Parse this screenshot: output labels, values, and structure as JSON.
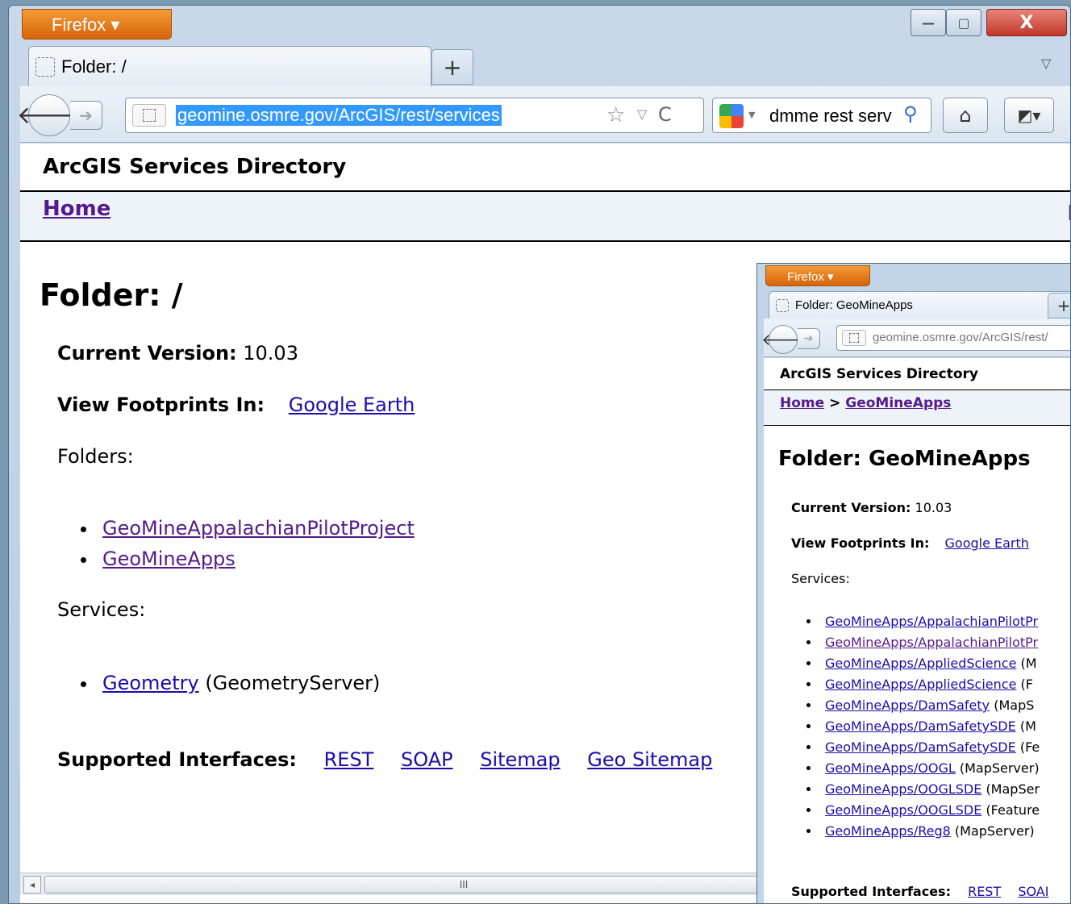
{
  "browser": {
    "menu_label": "Firefox ▾",
    "minimize": "—",
    "maximize": "▢",
    "close": "X",
    "tab_title": "Folder: /",
    "new_tab": "+",
    "tab_list": "▽",
    "back": "🡐",
    "forward": "➔",
    "url": "geomine.osmre.gov/ArcGIS/rest/services",
    "star": "☆",
    "url_dropdown": "▽",
    "reload": "C",
    "search_query": "dmme rest serv",
    "search_icon": "⚲",
    "home_icon": "⌂",
    "bookmarks_icon": "◩▾"
  },
  "page": {
    "header": "ArcGIS Services Directory",
    "home_link": "Home",
    "nav_right_fragment": "I",
    "title": "Folder: /",
    "current_version_label": "Current Version:",
    "current_version": "10.03",
    "view_footprints_label": "View Footprints In:",
    "google_earth": "Google Earth",
    "folders_label": "Folders:",
    "folders": [
      "GeoMineAppalachianPilotProject",
      "GeoMineApps"
    ],
    "services_label": "Services:",
    "service_link": "Geometry",
    "service_type": "(GeometryServer)",
    "interfaces_label": "Supported Interfaces:",
    "interfaces": [
      "REST",
      "SOAP",
      "Sitemap",
      "Geo Sitemap"
    ],
    "scroll_grip": "III",
    "scroll_left": "◂"
  },
  "inset": {
    "menu_label": "Firefox ▾",
    "tab_title": "Folder: GeoMineApps",
    "new_tab": "+",
    "back": "🡐",
    "forward": "➔",
    "url": "geomine.osmre.gov/ArcGIS/rest/",
    "header": "ArcGIS Services Directory",
    "breadcrumb_home": "Home",
    "breadcrumb_sep": ">",
    "breadcrumb_folder": "GeoMineApps",
    "title": "Folder: GeoMineApps",
    "current_version_label": "Current Version:",
    "current_version": "10.03",
    "view_footprints_label": "View Footprints In:",
    "google_earth": "Google Earth",
    "services_label": "Services:",
    "services": [
      {
        "link": "GeoMineApps/AppalachianPilotPr",
        "type": ""
      },
      {
        "link": "GeoMineApps/AppalachianPilotPr",
        "type": ""
      },
      {
        "link": "GeoMineApps/AppliedScience",
        "type": "(M"
      },
      {
        "link": "GeoMineApps/AppliedScience",
        "type": "(F"
      },
      {
        "link": "GeoMineApps/DamSafety",
        "type": "(MapS"
      },
      {
        "link": "GeoMineApps/DamSafetySDE",
        "type": "(M"
      },
      {
        "link": "GeoMineApps/DamSafetySDE",
        "type": "(Fe"
      },
      {
        "link": "GeoMineApps/OOGL",
        "type": "(MapServer)"
      },
      {
        "link": "GeoMineApps/OOGLSDE",
        "type": "(MapSer"
      },
      {
        "link": "GeoMineApps/OOGLSDE",
        "type": "(Feature"
      },
      {
        "link": "GeoMineApps/Reg8",
        "type": "(MapServer)"
      }
    ],
    "interfaces_label": "Supported Interfaces:",
    "interfaces": [
      "REST",
      "SOAI"
    ]
  }
}
